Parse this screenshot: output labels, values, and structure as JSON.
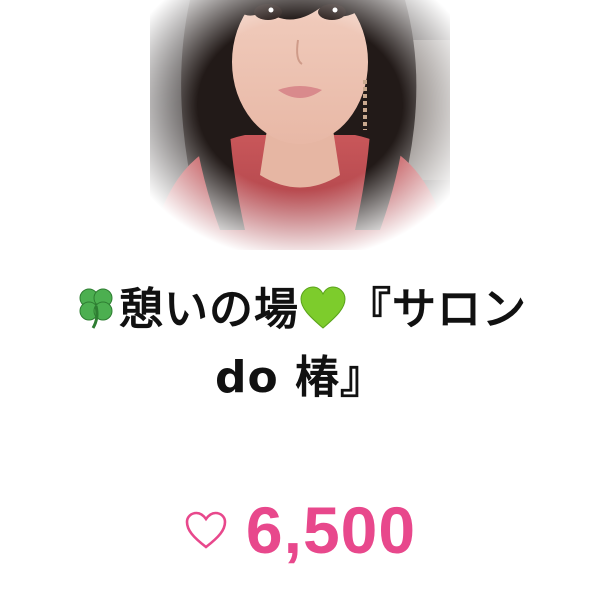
{
  "post": {
    "title": "🍀憩いの場💚『サロン do 椿』",
    "title_parts": {
      "text_a": "憩いの場",
      "text_b": "『サロン do 椿』"
    },
    "likes": {
      "icon": "heart-outline-icon",
      "count": "6,500"
    }
  },
  "colors": {
    "accent": "#e8488c",
    "title": "#111111",
    "clover": "#4caf50",
    "green_heart": "#7dcc2c"
  }
}
